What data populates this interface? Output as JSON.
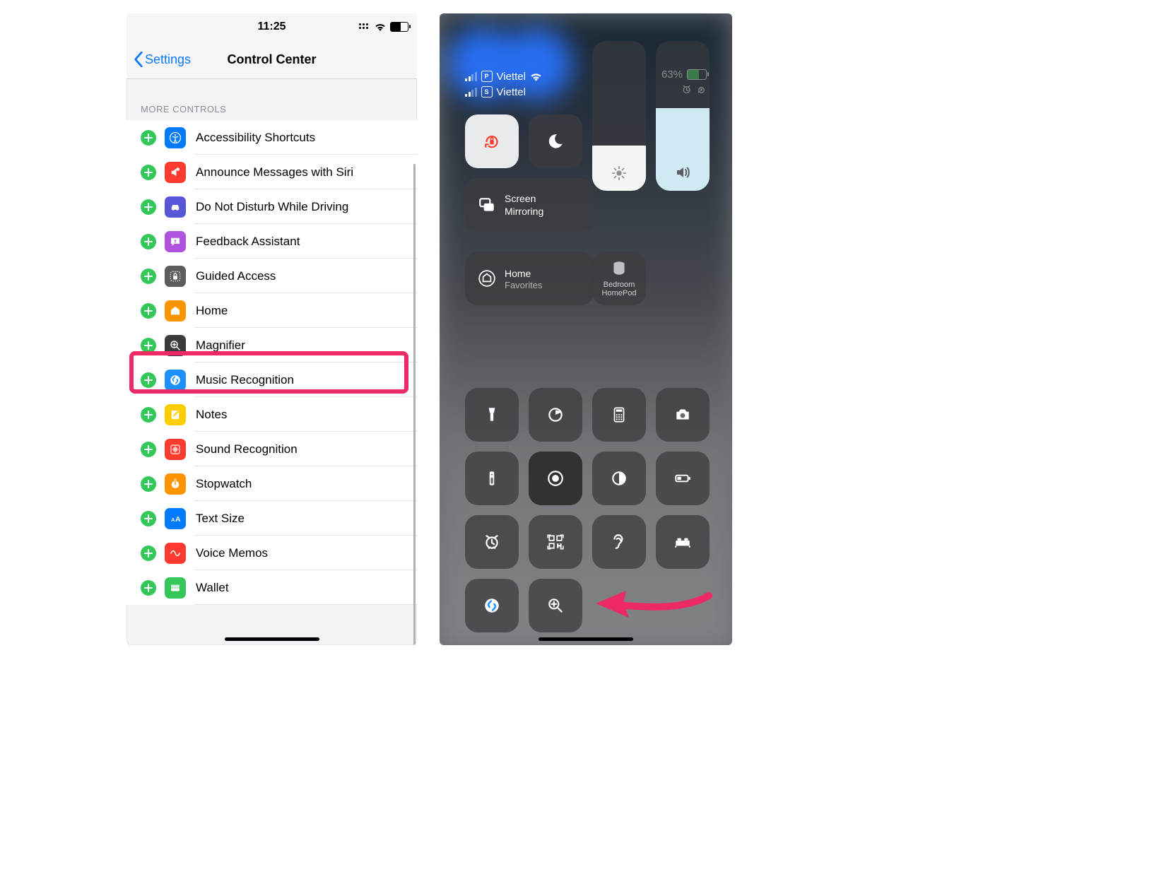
{
  "left": {
    "status": {
      "time": "11:25"
    },
    "nav": {
      "back": "Settings",
      "title": "Control Center"
    },
    "section_header": "MORE CONTROLS",
    "items": [
      {
        "label": "Accessibility Shortcuts",
        "icon": "accessibility-icon",
        "bg": "ic-blue"
      },
      {
        "label": "Announce Messages with Siri",
        "icon": "announce-icon",
        "bg": "ic-red"
      },
      {
        "label": "Do Not Disturb While Driving",
        "icon": "car-icon",
        "bg": "ic-purple"
      },
      {
        "label": "Feedback Assistant",
        "icon": "feedback-icon",
        "bg": "ic-purplelight"
      },
      {
        "label": "Guided Access",
        "icon": "lock-icon",
        "bg": "ic-dark"
      },
      {
        "label": "Home",
        "icon": "home-icon",
        "bg": "ic-orange"
      },
      {
        "label": "Magnifier",
        "icon": "magnifier-icon",
        "bg": "ic-grey",
        "highlight": true
      },
      {
        "label": "Music Recognition",
        "icon": "shazam-icon",
        "bg": "ic-azure"
      },
      {
        "label": "Notes",
        "icon": "notes-icon",
        "bg": "ic-yellow"
      },
      {
        "label": "Sound Recognition",
        "icon": "sound-icon",
        "bg": "ic-red2"
      },
      {
        "label": "Stopwatch",
        "icon": "stopwatch-icon",
        "bg": "ic-orange"
      },
      {
        "label": "Text Size",
        "icon": "textsize-icon",
        "bg": "ic-blue"
      },
      {
        "label": "Voice Memos",
        "icon": "voicememo-icon",
        "bg": "ic-red2"
      },
      {
        "label": "Wallet",
        "icon": "wallet-icon",
        "bg": "ic-green"
      }
    ]
  },
  "right": {
    "status": {
      "carrier1": "Viettel",
      "sim1": "P",
      "carrier2": "Viettel",
      "sim2": "S",
      "battery_pct": "63%"
    },
    "screen_mirroring": {
      "title": "Screen",
      "subtitle": "Mirroring"
    },
    "home_tile": {
      "title": "Home",
      "subtitle": "Favorites"
    },
    "homepod_tile": {
      "line1": "Bedroom",
      "line2": "HomePod"
    },
    "brightness_pct": 30,
    "volume_pct": 55,
    "grid_icons": [
      "flashlight-icon",
      "timer-icon",
      "calculator-icon",
      "camera-icon",
      "remote-icon",
      "screenrecord-icon",
      "darkmode-icon",
      "lowpower-icon",
      "alarm-icon",
      "qrcode-icon",
      "hearing-icon",
      "sleep-icon",
      "shazam-icon",
      "magnifier-icon"
    ]
  },
  "annotations": {
    "highlight_color": "#ed2a65",
    "arrow_color": "#ed2a65"
  }
}
